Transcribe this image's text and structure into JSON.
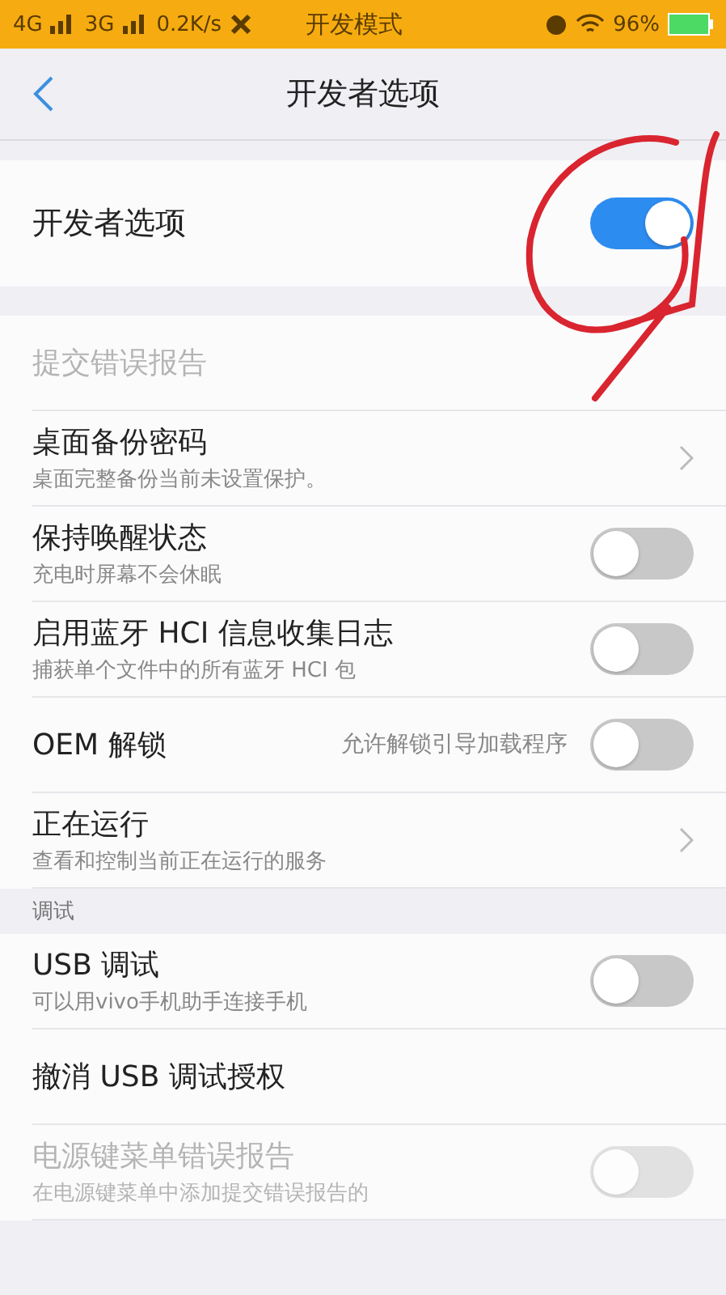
{
  "status_bar": {
    "network_1": "4G",
    "network_2": "3G",
    "speed": "0.2K/s",
    "mode": "开发模式",
    "battery": "96%"
  },
  "header": {
    "title": "开发者选项"
  },
  "master": {
    "label": "开发者选项",
    "on": true
  },
  "items": [
    {
      "kind": "plain",
      "title": "提交错误报告",
      "disabled": true
    },
    {
      "kind": "link",
      "title": "桌面备份密码",
      "subtitle": "桌面完整备份当前未设置保护。",
      "disabled": false
    },
    {
      "kind": "toggle",
      "title": "保持唤醒状态",
      "subtitle": "充电时屏幕不会休眠",
      "on": false,
      "disabled": false
    },
    {
      "kind": "toggle",
      "title": "启用蓝牙 HCI 信息收集日志",
      "subtitle": "捕获单个文件中的所有蓝牙 HCI 包",
      "on": false,
      "disabled": false
    },
    {
      "kind": "toggle",
      "title": "OEM 解锁",
      "value": "允许解锁引导加载程序",
      "on": false,
      "disabled": false
    },
    {
      "kind": "link",
      "title": "正在运行",
      "subtitle": "查看和控制当前正在运行的服务",
      "disabled": false
    },
    {
      "kind": "section",
      "title": "调试"
    },
    {
      "kind": "toggle",
      "title": "USB 调试",
      "subtitle": "可以用vivo手机助手连接手机",
      "on": false,
      "disabled": false
    },
    {
      "kind": "plain",
      "title": "撤消 USB 调试授权",
      "disabled": false
    },
    {
      "kind": "toggle",
      "title": "电源键菜单错误报告",
      "subtitle": "在电源键菜单中添加提交错误报告的",
      "on": false,
      "disabled": true
    }
  ]
}
